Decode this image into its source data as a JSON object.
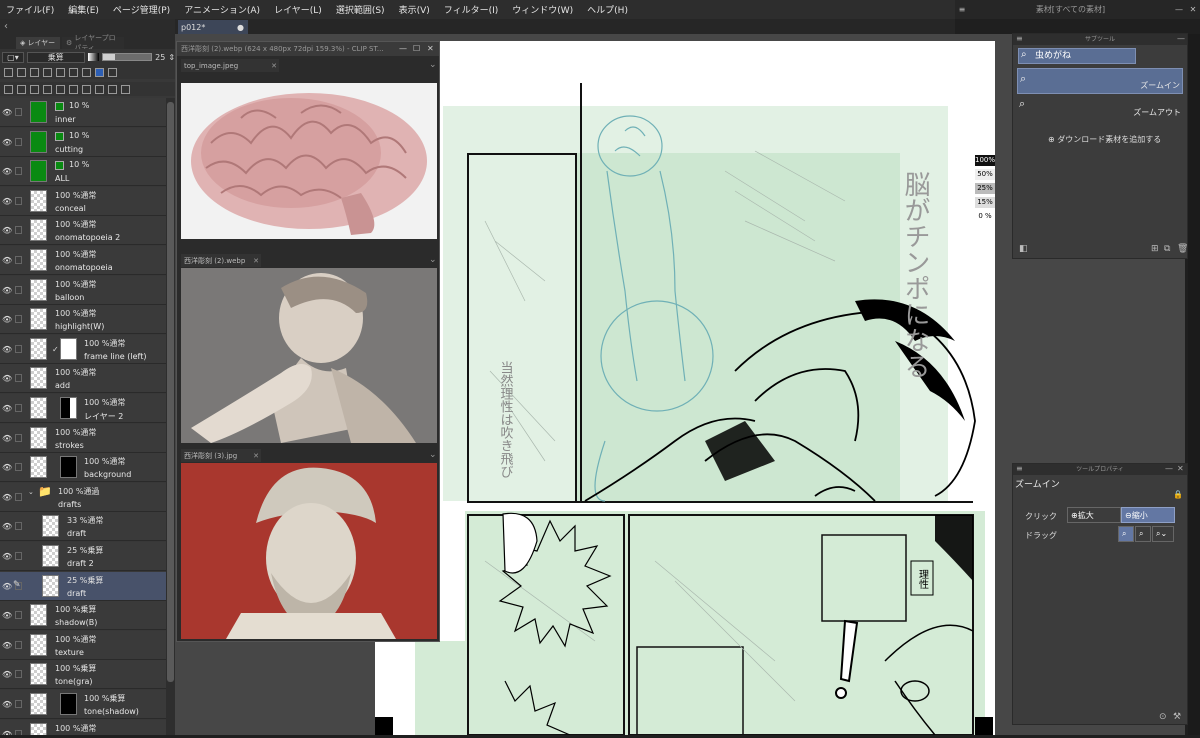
{
  "menu": [
    "ファイル(F)",
    "編集(E)",
    "ページ管理(P)",
    "アニメーション(A)",
    "レイヤー(L)",
    "選択範囲(S)",
    "表示(V)",
    "フィルター(I)",
    "ウィンドウ(W)",
    "ヘルプ(H)"
  ],
  "menu_right_title": "素材[すべての素材]",
  "layer_panel": {
    "tab_layer": "レイヤー",
    "tab_property": "レイヤープロパティ",
    "blend_mode": "乗算",
    "opacity": "25",
    "layers": [
      {
        "mode": "10 %",
        "name": "inner",
        "thumb": "green",
        "icon": true
      },
      {
        "mode": "10 %",
        "name": "cutting",
        "thumb": "green",
        "icon": true
      },
      {
        "mode": "10 %",
        "name": "ALL",
        "thumb": "green",
        "icon": true
      },
      {
        "mode": "100 %通常",
        "name": "conceal",
        "thumb": "checker"
      },
      {
        "mode": "100 %通常",
        "name": "onomatopoeia 2",
        "thumb": "checker"
      },
      {
        "mode": "100 %通常",
        "name": "onomatopoeia",
        "thumb": "checker"
      },
      {
        "mode": "100 %通常",
        "name": "balloon",
        "thumb": "checker"
      },
      {
        "mode": "100 %通常",
        "name": "highlight(W)",
        "thumb": "checker"
      },
      {
        "mode": "100 %通常",
        "name": "frame line (left)",
        "thumb": "white",
        "mask": true
      },
      {
        "mode": "100 %通常",
        "name": "add",
        "thumb": "checker"
      },
      {
        "mode": "100 %通常",
        "name": "レイヤー 2",
        "thumb": "half",
        "mask": true
      },
      {
        "mode": "100 %通常",
        "name": "strokes",
        "thumb": "checker"
      },
      {
        "mode": "100 %通常",
        "name": "background",
        "thumb": "black",
        "mask": true
      },
      {
        "mode": "100 %通過",
        "name": "drafts",
        "thumb": "folder"
      },
      {
        "mode": "33 %通常",
        "name": "draft",
        "thumb": "checker",
        "indent": true
      },
      {
        "mode": "25 %乗算",
        "name": "draft 2",
        "thumb": "checker",
        "indent": true
      },
      {
        "mode": "25 %乗算",
        "name": "draft",
        "thumb": "checker",
        "indent": true,
        "selected": true
      },
      {
        "mode": "100 %乗算",
        "name": "shadow(B)",
        "thumb": "checker"
      },
      {
        "mode": "100 %通常",
        "name": "texture",
        "thumb": "checker"
      },
      {
        "mode": "100 %乗算",
        "name": "tone(gra)",
        "thumb": "checker"
      },
      {
        "mode": "100 %乗算",
        "name": "tone(shadow)",
        "thumb": "black",
        "mask": true
      },
      {
        "mode": "100 %通常",
        "name": "",
        "thumb": "checker"
      }
    ]
  },
  "doc_tab": "p012*",
  "subview": {
    "title": "西洋彫刻 (2).webp (624 x 480px 72dpi 159.3%) - CLIP ST...",
    "images": [
      {
        "name": "top_image.jpeg"
      },
      {
        "name": "西洋彫刻 (2).webp"
      },
      {
        "name": "西洋彫刻 (3).jpg"
      }
    ]
  },
  "zoom_labels": [
    "100%",
    "50%",
    "25%",
    "15%",
    "0 %"
  ],
  "material_panel": {
    "title": "サブツール",
    "search": "虫めがね",
    "items": [
      "ズームイン",
      "ズームアウト"
    ],
    "add": "ダウンロード素材を追加する"
  },
  "tool_property": {
    "title": "ツールプロパティ",
    "tool_name": "ズームイン",
    "click_label": "クリック",
    "zoom_in_btn": "拡大",
    "zoom_out_btn": "縮小",
    "drag_label": "ドラッグ"
  },
  "page_text": {
    "vertical_main": "脳がチンポになる",
    "reason": "理性",
    "small1": "当然理性は吹き飛び"
  }
}
